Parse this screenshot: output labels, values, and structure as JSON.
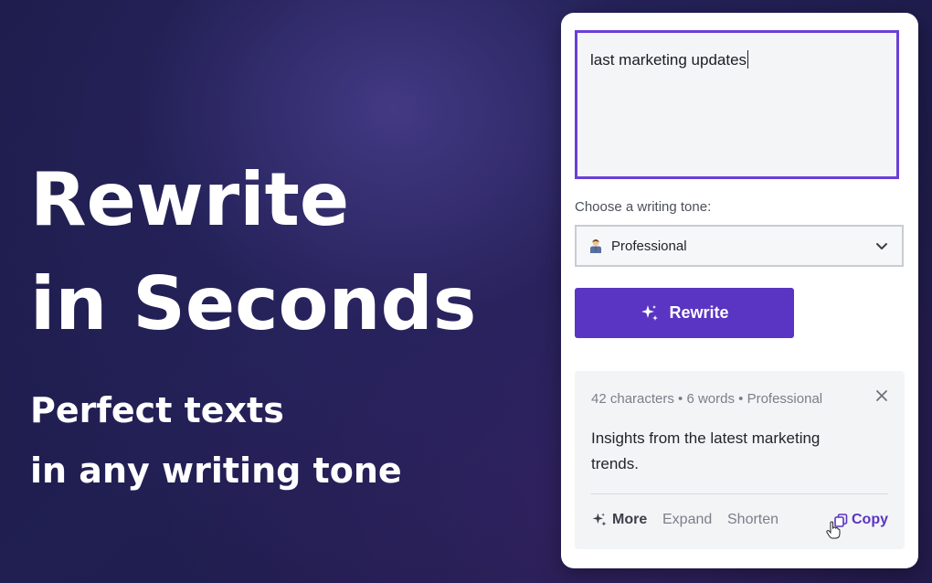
{
  "hero": {
    "title_line1": "Rewrite",
    "title_line2": "in Seconds",
    "subtitle_line1": "Perfect texts",
    "subtitle_line2": "in any writing tone"
  },
  "panel": {
    "input_value": "last marketing updates",
    "tone_label": "Choose a writing tone:",
    "tone_selected": "Professional",
    "tone_icon": "businessman-emoji",
    "rewrite_label": "Rewrite",
    "result": {
      "meta": "42 characters • 6 words • Professional",
      "text": "Insights from the latest marketing trends.",
      "actions": {
        "more": "More",
        "expand": "Expand",
        "shorten": "Shorten",
        "copy": "Copy"
      }
    }
  },
  "colors": {
    "accent": "#5a34c2",
    "focus_border": "#6a3fd8",
    "background": "#1b1a45"
  }
}
